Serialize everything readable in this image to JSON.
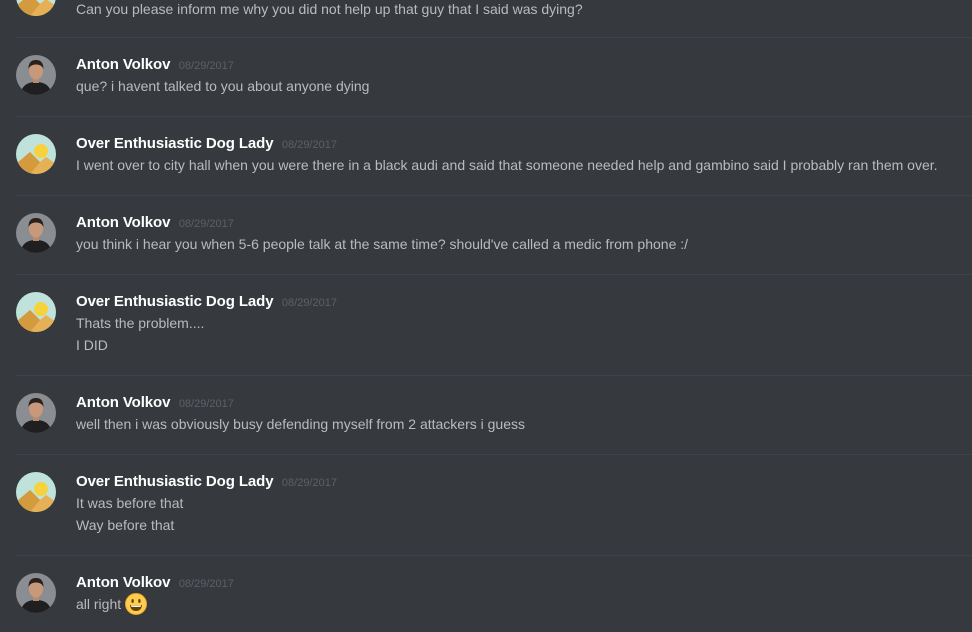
{
  "messages": [
    {
      "author": "",
      "avatar": "desert-avatar",
      "timestamp": "",
      "lines": [
        "Can you please inform me why you did not help up that guy that I said was dying?"
      ]
    },
    {
      "author": "Anton Volkov",
      "avatar": "man-avatar",
      "timestamp": "08/29/2017",
      "lines": [
        "que? i havent talked to you about anyone dying"
      ]
    },
    {
      "author": "Over Enthusiastic Dog Lady",
      "avatar": "desert-avatar",
      "timestamp": "08/29/2017",
      "lines": [
        "I went over to city hall when you were there in a black audi and said that someone needed help and gambino said I probably ran them over."
      ]
    },
    {
      "author": "Anton Volkov",
      "avatar": "man-avatar",
      "timestamp": "08/29/2017",
      "lines": [
        "you think i hear you when 5-6 people talk at the same time? should've called a medic from phone :/"
      ]
    },
    {
      "author": "Over Enthusiastic Dog Lady",
      "avatar": "desert-avatar",
      "timestamp": "08/29/2017",
      "lines": [
        "Thats the problem....",
        "I DID"
      ]
    },
    {
      "author": "Anton Volkov",
      "avatar": "man-avatar",
      "timestamp": "08/29/2017",
      "lines": [
        "well then i was obviously busy defending myself from 2 attackers i guess"
      ]
    },
    {
      "author": "Over Enthusiastic Dog Lady",
      "avatar": "desert-avatar",
      "timestamp": "08/29/2017",
      "lines": [
        "It was before that",
        "Way before that"
      ]
    },
    {
      "author": "Anton Volkov",
      "avatar": "man-avatar",
      "timestamp": "08/29/2017",
      "lines": [
        "all right"
      ],
      "emoji": "smiley-emoji"
    }
  ],
  "colors": {
    "background": "#36393e",
    "divider": "#3f4248",
    "username": "#ffffff",
    "timestamp": "#5d6066",
    "message_text": "#b9bbbe"
  }
}
